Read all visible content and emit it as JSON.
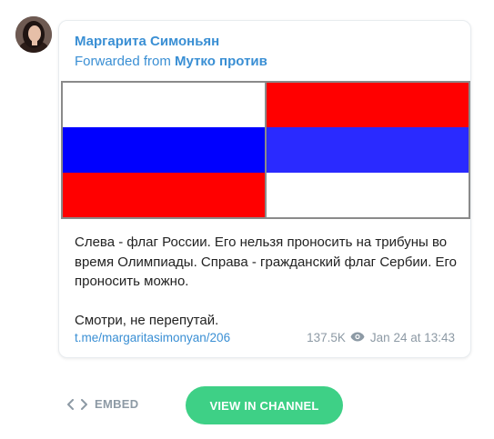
{
  "post": {
    "author": "Маргарита Симоньян",
    "forwarded_prefix": "Forwarded from ",
    "forwarded_source": "Мутко против",
    "text_paragraph_1": "Слева - флаг России. Его нельзя проносить на трибуны во время Олимпиады. Справа - гражданский флаг Сербии. Его проносить можно.",
    "text_paragraph_2": "Смотри, не перепутай.",
    "link": "t.me/margaritasimonyan/206",
    "views": "137.5K",
    "timestamp": "Jan 24 at 13:43"
  },
  "image": {
    "left_flag_colors": [
      "#ffffff",
      "#0000ff",
      "#ff0000"
    ],
    "right_flag_colors": [
      "#ff0000",
      "#2a2aff",
      "#ffffff"
    ]
  },
  "actions": {
    "embed_label": "EMBED",
    "view_label": "VIEW IN CHANNEL"
  },
  "colors": {
    "accent_blue": "#3a8fd4",
    "button_green": "#3ed086",
    "muted": "#8d9aa5"
  },
  "icons": {
    "views": "eye-icon",
    "embed": "code-brackets-icon"
  }
}
